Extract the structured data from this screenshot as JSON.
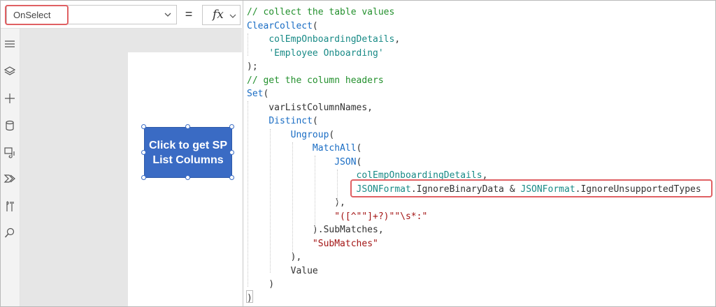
{
  "formula_bar": {
    "property": "OnSelect",
    "equals": "=",
    "fx_label": "fx"
  },
  "sidebar": {
    "items": [
      {
        "icon": "hamburger-icon"
      },
      {
        "icon": "layers-icon"
      },
      {
        "icon": "plus-icon"
      },
      {
        "icon": "database-icon"
      },
      {
        "icon": "media-icon"
      },
      {
        "icon": "power-automate-icon"
      },
      {
        "icon": "tools-icon"
      },
      {
        "icon": "search-icon"
      }
    ]
  },
  "canvas": {
    "button": {
      "line1": "Click to get SP",
      "line2": "List Columns"
    }
  },
  "code": {
    "lines": [
      [
        {
          "t": "cm",
          "s": "// collect the table values"
        }
      ],
      [
        {
          "t": "fn",
          "s": "ClearCollect"
        },
        {
          "t": "txt",
          "s": "("
        }
      ],
      [
        {
          "t": "txt",
          "s": "    "
        },
        {
          "t": "id",
          "s": "colEmpOnboardingDetails"
        },
        {
          "t": "txt",
          "s": ","
        }
      ],
      [
        {
          "t": "txt",
          "s": "    "
        },
        {
          "t": "id",
          "s": "'Employee Onboarding'"
        }
      ],
      [
        {
          "t": "txt",
          "s": ");"
        }
      ],
      [
        {
          "t": "cm",
          "s": "// get the column headers"
        }
      ],
      [
        {
          "t": "fn",
          "s": "Set"
        },
        {
          "t": "txt",
          "s": "("
        }
      ],
      [
        {
          "t": "txt",
          "s": "    varListColumnNames,"
        }
      ],
      [
        {
          "t": "txt",
          "s": "    "
        },
        {
          "t": "fn",
          "s": "Distinct"
        },
        {
          "t": "txt",
          "s": "("
        }
      ],
      [
        {
          "t": "txt",
          "s": "        "
        },
        {
          "t": "fn",
          "s": "Ungroup"
        },
        {
          "t": "txt",
          "s": "("
        }
      ],
      [
        {
          "t": "txt",
          "s": "            "
        },
        {
          "t": "fn",
          "s": "MatchAll"
        },
        {
          "t": "txt",
          "s": "("
        }
      ],
      [
        {
          "t": "txt",
          "s": "                "
        },
        {
          "t": "fn",
          "s": "JSON"
        },
        {
          "t": "txt",
          "s": "("
        }
      ],
      [
        {
          "t": "txt",
          "s": "                    "
        },
        {
          "t": "id",
          "s": "colEmpOnboardingDetails"
        },
        {
          "t": "txt",
          "s": ","
        }
      ],
      [
        {
          "t": "txt",
          "s": "                    "
        },
        {
          "t": "id",
          "s": "JSONFormat"
        },
        {
          "t": "txt",
          "s": ".IgnoreBinaryData & "
        },
        {
          "t": "id",
          "s": "JSONFormat"
        },
        {
          "t": "txt",
          "s": ".IgnoreUnsupportedTypes"
        }
      ],
      [
        {
          "t": "txt",
          "s": "                ),"
        }
      ],
      [
        {
          "t": "txt",
          "s": "                "
        },
        {
          "t": "str",
          "s": "\"([^\"\"]+?)\"\"\\s*:\""
        }
      ],
      [
        {
          "t": "txt",
          "s": "            ).SubMatches,"
        }
      ],
      [
        {
          "t": "txt",
          "s": "            "
        },
        {
          "t": "str",
          "s": "\"SubMatches\""
        }
      ],
      [
        {
          "t": "txt",
          "s": "        ),"
        }
      ],
      [
        {
          "t": "txt",
          "s": "        Value"
        }
      ],
      [
        {
          "t": "txt",
          "s": "    )"
        }
      ],
      [
        {
          "t": "txt",
          "s": ")"
        }
      ]
    ]
  },
  "colors": {
    "accent_button": "#3a6bc4",
    "highlight_box": "#e06063",
    "comment": "#23902d",
    "function": "#1a6dc4",
    "identifier": "#188a86",
    "string": "#a31515"
  }
}
